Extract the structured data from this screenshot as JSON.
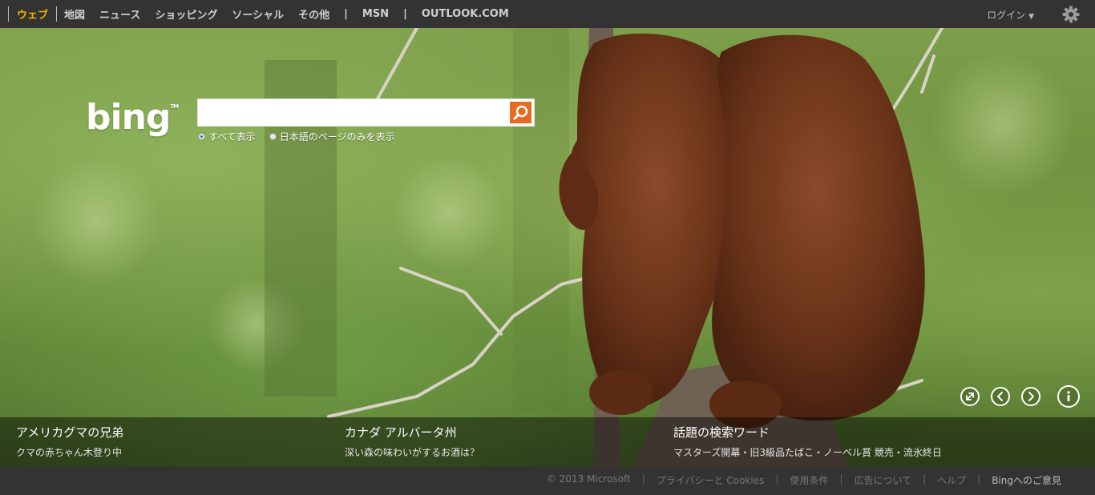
{
  "nav": {
    "items": [
      "ウェブ",
      "地図",
      "ニュース",
      "ショッピング",
      "ソーシャル",
      "その他"
    ],
    "separator": "|",
    "msn": "MSN",
    "outlook": "OUTLOOK.COM",
    "login": "ログイン",
    "active_color": "#f4b400"
  },
  "search": {
    "logo": "bing",
    "trademark": "TM",
    "value": "",
    "options": [
      "すべて表示",
      "日本語のページのみを表示"
    ],
    "selected_option": "すべて表示",
    "button_color": "#e66a22"
  },
  "controls": [
    "expand-icon",
    "previous-icon",
    "next-icon",
    "info-icon"
  ],
  "captions": [
    {
      "title": "アメリカグマの兄弟",
      "subtitle": "クマの赤ちゃん木登り中"
    },
    {
      "title": "カナダ アルバータ州",
      "subtitle": "深い森の味わいがするお酒は？"
    },
    {
      "title": "話題の検索ワード",
      "subtitle": "マスターズ開幕・旧3級品たばこ・ノーベル賞 競売・流氷終日"
    }
  ],
  "footer": {
    "copyright": "© 2013 Microsoft",
    "links": [
      "プライバシーと Cookies",
      "使用条件",
      "広告について",
      "ヘルプ"
    ],
    "feedback": "Bingへのご意見"
  }
}
